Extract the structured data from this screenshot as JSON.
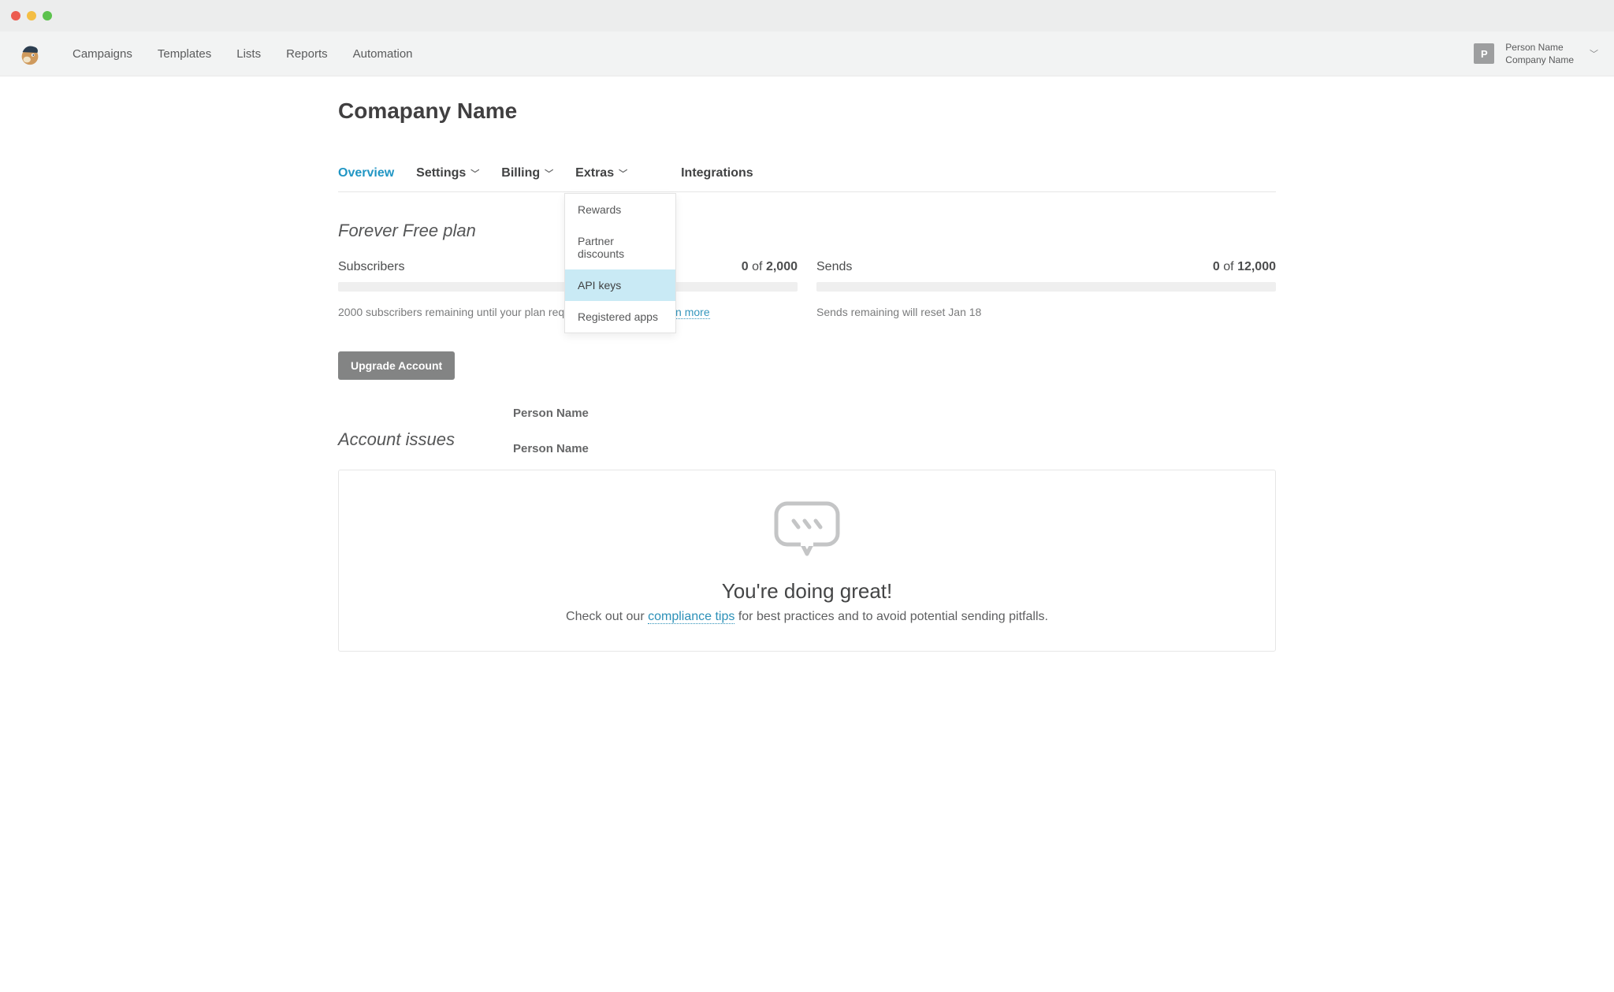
{
  "nav": {
    "links": [
      "Campaigns",
      "Templates",
      "Lists",
      "Reports",
      "Automation"
    ]
  },
  "account_menu": {
    "avatar_letter": "P",
    "line1": "Person Name",
    "line2": "Company Name"
  },
  "page_title": "Comapany Name",
  "tabs": {
    "overview": "Overview",
    "settings": "Settings",
    "billing": "Billing",
    "extras": "Extras",
    "integrations": "Integrations"
  },
  "extras_dropdown": [
    "Rewards",
    "Partner discounts",
    "API keys",
    "Registered apps"
  ],
  "plan": {
    "heading": "Forever Free plan",
    "subscribers": {
      "label": "Subscribers",
      "count": "0",
      "divider": "of",
      "limit": "2,000",
      "note_prefix": "2000 subscribers remaining until your plan requires an upgrade. ",
      "learn_more": "Learn more"
    },
    "sends": {
      "label": "Sends",
      "count": "0",
      "divider": "of",
      "limit": "12,000",
      "note": "Sends remaining will reset Jan 18"
    },
    "upgrade_label": "Upgrade Account"
  },
  "loose_labels": {
    "a": "Person Name",
    "b": "Person Name"
  },
  "issues": {
    "heading": "Account issues",
    "title": "You're doing great!",
    "text_before": "Check out our ",
    "link": "compliance tips",
    "text_after": " for best practices and to avoid potential sending pitfalls."
  }
}
